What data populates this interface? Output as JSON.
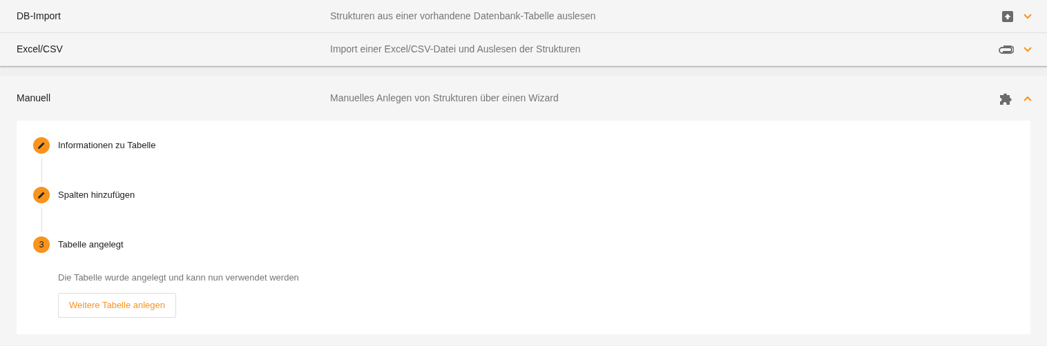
{
  "panels": [
    {
      "title": "DB-Import",
      "description": "Strukturen aus einer vorhandene Datenbank-Tabelle auslesen",
      "kind": "upload",
      "expanded": false
    },
    {
      "title": "Excel/CSV",
      "description": "Import einer Excel/CSV-Datei und Auslesen der Strukturen",
      "kind": "attachment",
      "expanded": false
    },
    {
      "title": "Manuell",
      "description": "Manuelles Anlegen von Strukturen über einen Wizard",
      "kind": "puzzle",
      "expanded": true,
      "steps": [
        {
          "kind": "edit",
          "label": "Informationen zu Tabelle"
        },
        {
          "kind": "edit",
          "label": "Spalten hinzufügen"
        },
        {
          "kind": "number",
          "number": "3",
          "label": "Tabelle angelegt",
          "message": "Die Tabelle wurde angelegt und kann nun verwendet werden",
          "button": "Weitere Tabelle anlegen"
        }
      ]
    }
  ]
}
